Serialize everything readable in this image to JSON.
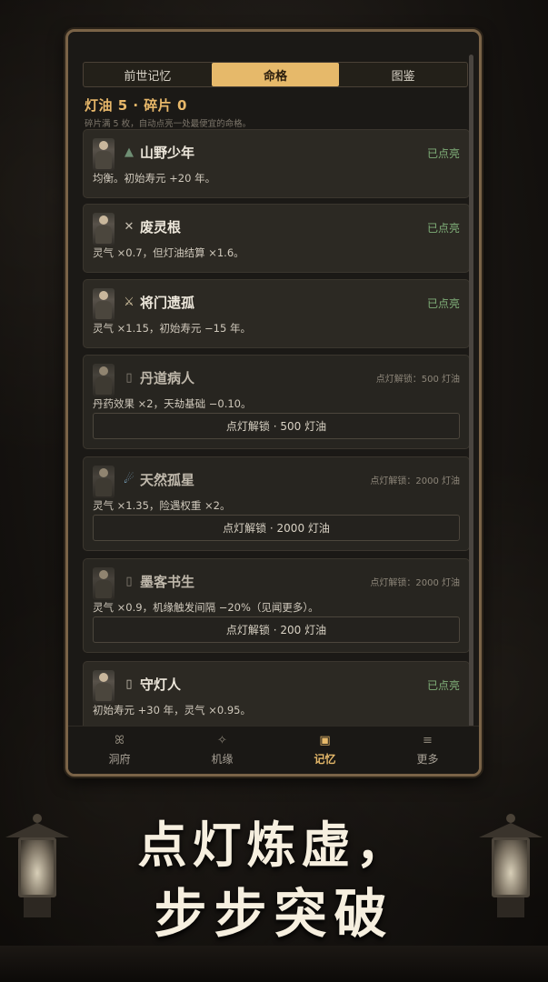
{
  "tabs": [
    "前世记忆",
    "命格",
    "图鉴"
  ],
  "active_tab": 1,
  "resources": "灯油 5 · 碎片 0",
  "hint": "碎片满 5 枚，自动点亮一处最便宜的命格。",
  "cards": [
    {
      "name": "山野少年",
      "icon": "▲",
      "icon_color": "#6f8f74",
      "status": "已点亮",
      "desc": "均衡。初始寿元 +20 年。",
      "locked": false
    },
    {
      "name": "废灵根",
      "icon": "✕",
      "icon_color": "#c8c0b2",
      "status": "已点亮",
      "desc": "灵气 ×0.7，但灯油结算 ×1.6。",
      "locked": false
    },
    {
      "name": "将门遗孤",
      "icon": "⚔",
      "icon_color": "#d9c9a6",
      "status": "已点亮",
      "desc": "灵气 ×1.15，初始寿元 −15 年。",
      "locked": false
    },
    {
      "name": "丹道病人",
      "icon": "▯",
      "icon_color": "#8a8378",
      "status": "点灯解锁：500 灯油",
      "desc": "丹药效果 ×2，天劫基础 −0.10。",
      "unlock": "点灯解锁 · 500 灯油",
      "locked": true
    },
    {
      "name": "天然孤星",
      "icon": "☄",
      "icon_color": "#8fc3e6",
      "status": "点灯解锁：2000 灯油",
      "desc": "灵气 ×1.35，险遇权重 ×2。",
      "unlock": "点灯解锁 · 2000 灯油",
      "locked": true
    },
    {
      "name": "墨客书生",
      "icon": "▯",
      "icon_color": "#8a8378",
      "status": "点灯解锁：2000 灯油",
      "desc": "灵气 ×0.9，机缘触发间隔 −20%（见闻更多）。",
      "unlock": "点灯解锁 · 200 灯油",
      "locked": true
    },
    {
      "name": "守灯人",
      "icon": "▯",
      "icon_color": "#c8c0b2",
      "status": "已点亮",
      "desc": "初始寿元 +30 年，灵气 ×0.95。",
      "locked": false
    }
  ],
  "nav": [
    {
      "label": "洞府",
      "icon": "ꕤ"
    },
    {
      "label": "机缘",
      "icon": "✧"
    },
    {
      "label": "记忆",
      "icon": "▣"
    },
    {
      "label": "更多",
      "icon": "≡"
    }
  ],
  "active_nav": 2,
  "slogan": [
    "点灯炼虚，",
    "步步突破"
  ]
}
